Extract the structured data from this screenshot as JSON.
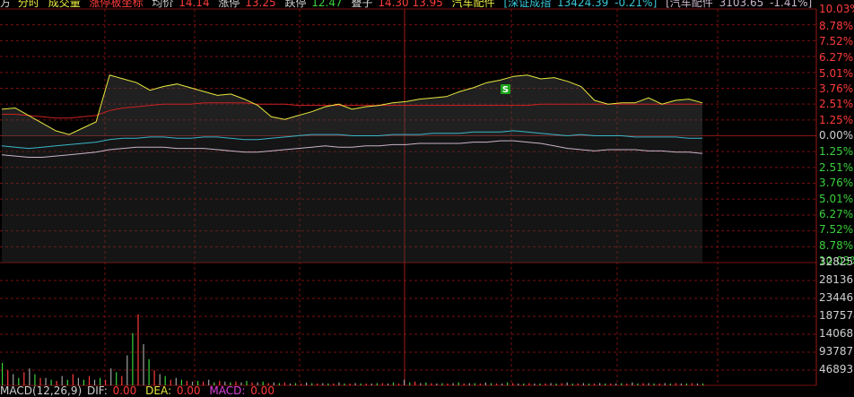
{
  "header": {
    "prefix": "方",
    "mode_label": "分时",
    "volume_label": "成交量",
    "limit_coord_label": "涨停板坐标",
    "avg_label": "均价",
    "avg_value": "14.14",
    "up_limit_label": "涨停",
    "up_limit_value": "13.25",
    "down_limit_label": "跌停",
    "down_limit_value": "12.47",
    "stack_label": "叠子",
    "stack_values": "14.30 13.95",
    "sector_label": "汽车配件",
    "index_bracket": "[深证成指",
    "index_value": "13424.39",
    "index_change": "-0.21%]",
    "sector_bracket": "[汽车配件",
    "sector_value": "3103.65",
    "sector_change": "-1.41%]"
  },
  "footer": {
    "macd_label": "MACD(12,26,9)",
    "dif_label": "DIF:",
    "dif_value": "0.00",
    "dea_label": "DEA:",
    "dea_value": "0.00",
    "macd_value_label": "MACD:",
    "macd_value": "0.00"
  },
  "price_axis": {
    "up_labels": [
      "10.03%",
      "8.78%",
      "7.52%",
      "6.27%",
      "5.01%",
      "3.76%",
      "2.51%",
      "1.25%"
    ],
    "zero_label": "0.00%",
    "down_labels": [
      "1.25%",
      "2.51%",
      "3.76%",
      "5.01%",
      "6.27%",
      "7.52%",
      "8.78%",
      "10.03%"
    ]
  },
  "volume_axis": {
    "labels": [
      "328254",
      "281361",
      "234467",
      "187574",
      "140680",
      "93787",
      "46893"
    ]
  },
  "signal_marker": {
    "label": "S",
    "color": "#1aa31a"
  },
  "colors": {
    "up": "#ff3b3b",
    "down": "#3bd13b",
    "grid": "#7a0f0f",
    "price_line": "#e8e840",
    "avg_line": "#cc2020",
    "index_line": "#3bb5c8",
    "sector_line": "#c8b4c8",
    "text_white": "#d0d0d0",
    "text_cyan": "#38c8d8",
    "macd_magenta": "#e040e0"
  },
  "chart_data": {
    "type": "line",
    "series": [
      {
        "values": [
          2.1,
          2.2,
          1.6,
          1.0,
          0.4,
          0.1,
          0.6,
          1.1,
          4.8,
          4.5,
          4.2,
          3.6,
          3.9,
          4.1,
          3.8,
          3.5,
          3.2,
          3.3,
          2.9,
          2.4,
          1.5,
          1.3,
          1.6,
          1.9,
          2.3,
          2.5,
          2.1,
          2.3,
          2.4,
          2.6,
          2.7,
          2.9,
          3.0,
          3.1,
          3.5,
          3.8,
          4.2,
          4.4,
          4.7,
          4.8,
          4.5,
          4.6,
          4.3,
          3.9,
          2.8,
          2.5,
          2.6,
          2.6,
          3.0,
          2.5,
          2.8,
          2.9,
          2.6
        ]
      },
      {
        "values": [
          1.7,
          1.7,
          1.6,
          1.5,
          1.4,
          1.4,
          1.5,
          1.6,
          2.0,
          2.2,
          2.3,
          2.4,
          2.5,
          2.5,
          2.5,
          2.6,
          2.6,
          2.6,
          2.6,
          2.5,
          2.5,
          2.5,
          2.4,
          2.4,
          2.4,
          2.4,
          2.4,
          2.4,
          2.4,
          2.4,
          2.4,
          2.4,
          2.4,
          2.4,
          2.4,
          2.4,
          2.4,
          2.4,
          2.4,
          2.4,
          2.5,
          2.5,
          2.5,
          2.5,
          2.5,
          2.5,
          2.5,
          2.5,
          2.5,
          2.5,
          2.5,
          2.5,
          2.5
        ]
      },
      {
        "values": [
          -0.8,
          -0.9,
          -1.0,
          -0.9,
          -0.8,
          -0.7,
          -0.6,
          -0.5,
          -0.3,
          -0.2,
          -0.2,
          -0.1,
          -0.1,
          -0.2,
          -0.2,
          -0.1,
          -0.1,
          -0.2,
          -0.3,
          -0.3,
          -0.2,
          -0.1,
          0.0,
          0.1,
          0.1,
          0.1,
          0.0,
          0.0,
          0.0,
          0.1,
          0.1,
          0.1,
          0.2,
          0.2,
          0.2,
          0.3,
          0.3,
          0.3,
          0.4,
          0.3,
          0.2,
          0.1,
          0.0,
          0.1,
          0.0,
          0.0,
          0.0,
          -0.1,
          -0.1,
          -0.1,
          -0.1,
          -0.2,
          -0.2
        ]
      },
      {
        "values": [
          -1.5,
          -1.6,
          -1.7,
          -1.7,
          -1.6,
          -1.5,
          -1.4,
          -1.3,
          -1.1,
          -1.0,
          -0.9,
          -0.9,
          -0.9,
          -1.0,
          -1.0,
          -1.0,
          -1.1,
          -1.2,
          -1.3,
          -1.3,
          -1.2,
          -1.1,
          -1.0,
          -0.9,
          -0.8,
          -0.9,
          -0.9,
          -0.8,
          -0.8,
          -0.7,
          -0.7,
          -0.6,
          -0.6,
          -0.6,
          -0.6,
          -0.5,
          -0.5,
          -0.4,
          -0.4,
          -0.5,
          -0.6,
          -0.8,
          -1.0,
          -1.1,
          -1.2,
          -1.1,
          -1.1,
          -1.1,
          -1.2,
          -1.2,
          -1.3,
          -1.3,
          -1.4
        ]
      }
    ],
    "ylim": [
      -10.03,
      10.03
    ],
    "volume": {
      "max": 328254,
      "values": [
        60000,
        40000,
        30000,
        20000,
        35000,
        45000,
        30000,
        20000,
        20000,
        15000,
        12000,
        25000,
        15000,
        30000,
        20000,
        15000,
        25000,
        15000,
        20000,
        15000,
        45000,
        35000,
        25000,
        80000,
        140000,
        190000,
        110000,
        70000,
        40000,
        30000,
        25000,
        15000,
        20000,
        15000,
        12000,
        10000,
        12000,
        10000,
        15000,
        8000,
        12000,
        10000,
        8000,
        10000,
        8000,
        12000,
        8000,
        8000,
        10000,
        6000,
        8000,
        6000,
        8000,
        5000,
        6000,
        5000,
        8000,
        6000,
        5000,
        6000,
        5000,
        5000,
        8000,
        5000,
        5000,
        6000,
        5000,
        5000,
        5000,
        6000,
        6000,
        5000,
        8000,
        5000,
        15000,
        8000,
        10000,
        6000,
        8000,
        6000,
        5000,
        6000,
        5000,
        6000,
        8000,
        5000,
        6000,
        6000,
        5000,
        8000,
        6000,
        5000,
        5000,
        8000,
        6000,
        5000,
        5000,
        6000,
        5000,
        5000,
        5000,
        6000,
        5000,
        6000,
        8000,
        5000,
        5000,
        6000,
        5000,
        5000,
        6000,
        5000,
        5000,
        5000,
        6000,
        5000,
        8000,
        5000,
        6000,
        6000,
        5000,
        5000,
        6000,
        5000,
        6000,
        5000,
        5000,
        6000,
        5000,
        5000
      ]
    }
  }
}
